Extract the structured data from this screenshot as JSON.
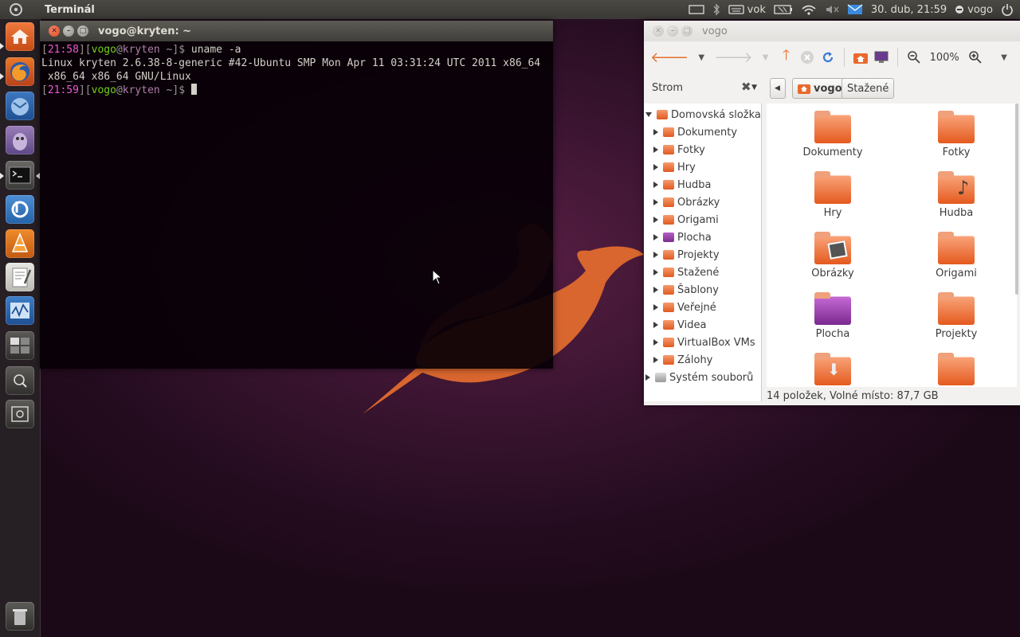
{
  "panel": {
    "app_title": "Terminál",
    "keyboard_layout": "vok",
    "datetime": "30. dub, 21:59",
    "user": "vogo"
  },
  "launcher": {
    "items": [
      "home-folder",
      "firefox",
      "thunderbird",
      "pidgin",
      "terminal",
      "banshee",
      "vlc",
      "text-editor",
      "system-monitor",
      "workspace-switcher",
      "zoom-in",
      "zoom-out"
    ],
    "trash": "trash"
  },
  "terminal": {
    "title": "vogo@kryten: ~",
    "lines": [
      {
        "time": "21:58",
        "user": "vogo",
        "host": "kryten",
        "path": "~",
        "command": "uname -a"
      },
      {
        "output": "Linux kryten 2.6.38-8-generic #42-Ubuntu SMP Mon Apr 11 03:31:24 UTC 2011 x86_64"
      },
      {
        "output": " x86_64 x86_64 GNU/Linux"
      },
      {
        "time": "21:59",
        "user": "vogo",
        "host": "kryten",
        "path": "~",
        "command": ""
      }
    ],
    "line1_time": "21:58",
    "line1_cmd": "uname -a",
    "out1": "Linux kryten 2.6.38-8-generic #42-Ubuntu SMP Mon Apr 11 03:31:24 UTC 2011 x86_64",
    "out2": " x86_64 x86_64 GNU/Linux",
    "line2_time": "21:59",
    "prompt_user": "vogo",
    "prompt_at": "@",
    "prompt_host": "kryten",
    "prompt_path": " ~",
    "prompt_dollar": "$"
  },
  "nautilus": {
    "title": "vogo",
    "zoom": "100%",
    "side_pane_mode": "Strom",
    "breadcrumbs": [
      "vogo",
      "Stažené"
    ],
    "tree": {
      "root": "Domovská složka",
      "children": [
        "Dokumenty",
        "Fotky",
        "Hry",
        "Hudba",
        "Obrázky",
        "Origami",
        "Plocha",
        "Projekty",
        "Stažené",
        "Šablony",
        "Veřejné",
        "Videa",
        "VirtualBox VMs",
        "Zálohy"
      ],
      "filesystem": "Systém souborů"
    },
    "icons": [
      "Dokumenty",
      "Fotky",
      "Hry",
      "Hudba",
      "Obrázky",
      "Origami",
      "Plocha",
      "Projekty",
      "",
      ""
    ],
    "status": "14 položek, Volné místo: 87,7 GB"
  },
  "colors": {
    "accent": "#e05a1f",
    "prompt_time": "#e85bd0",
    "prompt_user": "#73d216"
  }
}
